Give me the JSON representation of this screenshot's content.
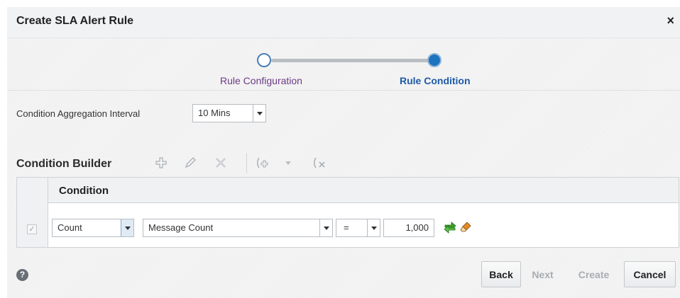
{
  "dialog": {
    "title": "Create SLA Alert Rule",
    "close_label": "×"
  },
  "train": {
    "steps": [
      {
        "label": "Rule Configuration",
        "state": "visited"
      },
      {
        "label": "Rule Condition",
        "state": "current"
      }
    ]
  },
  "aggregation": {
    "label": "Condition Aggregation Interval",
    "value": "10 Mins"
  },
  "condition_builder": {
    "title": "Condition Builder",
    "toolbar_icons": [
      "add-icon",
      "edit-icon",
      "delete-icon",
      "group-icon",
      "dropdown-arrow-icon",
      "ungroup-icon"
    ],
    "column_header": "Condition",
    "rows": [
      {
        "checked": true,
        "function": "Count",
        "metric": "Message Count",
        "operator": "=",
        "value": "1,000",
        "icons": [
          "refresh-icon",
          "eraser-icon"
        ]
      }
    ]
  },
  "footer": {
    "help_label": "?",
    "buttons": {
      "back": "Back",
      "next": "Next",
      "create": "Create",
      "cancel": "Cancel"
    }
  },
  "colors": {
    "current_step": "#1e73be",
    "visited_step_label": "#6b3a86",
    "current_step_label": "#1e5aa8",
    "disabled_text": "#a8adb2"
  }
}
